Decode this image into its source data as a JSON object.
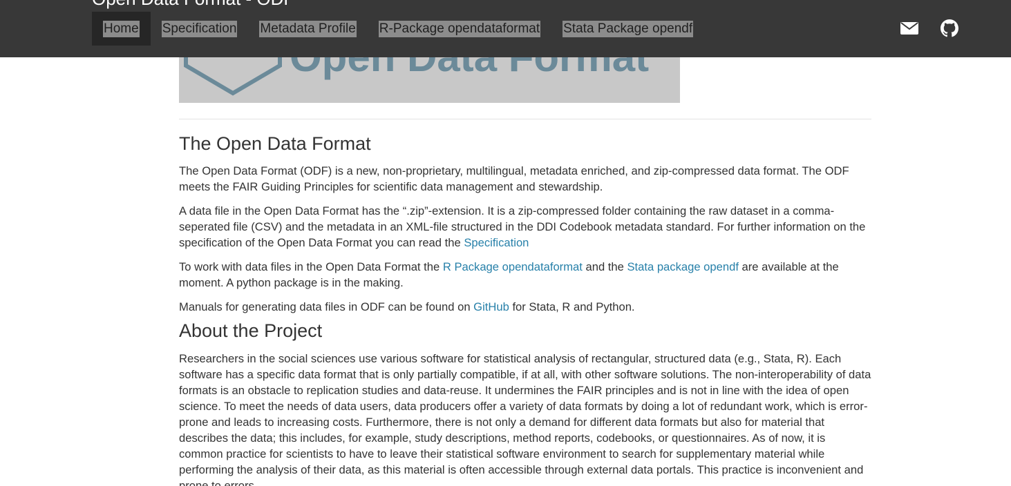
{
  "navbar": {
    "brand": "Open Data Format - ODF",
    "items": [
      {
        "label": "Home"
      },
      {
        "label": "Specification"
      },
      {
        "label": "Metadata Profile"
      },
      {
        "label": "R-Package opendataformat"
      },
      {
        "label": "Stata Package opendf"
      }
    ],
    "icons": [
      "envelope-icon",
      "github-icon"
    ]
  },
  "logo": {
    "text": "Open Data Format"
  },
  "section1": {
    "title": "The Open Data Format",
    "p1": "The Open Data Format (ODF) is a new, non-proprietary, multilingual, metadata enriched, and zip-compressed data format. The ODF meets the FAIR Guiding Principles for scientific data management and stewardship.",
    "p2_text": "A data file in the Open Data Format has the “.zip”-extension. It is a zip-compressed folder containing the raw dataset in a comma-seperated file (CSV) and the metadata in an XML-file structured in the DDI Codebook metadata standard. For further information on the specification of the Open Data Format you can read the ",
    "p2_link": "Specification",
    "p3_a": "To work with data files in the Open Data Format the ",
    "p3_link1": "R Package opendataformat",
    "p3_b": " and the ",
    "p3_link2": "Stata package opendf",
    "p3_c": " are available at the moment. A python package is in the making.",
    "p4_a": "Manuals for generating data files in ODF can be found on ",
    "p4_link": "GitHub",
    "p4_b": " for Stata, R and Python."
  },
  "section2": {
    "title": "About the Project",
    "p1": "Researchers in the social sciences use various software for statistical analysis of rectangular, structured data (e.g., Stata, R). Each software has a specific data format that is only partially compatible, if at all, with other software solutions. The non-interoperability of data formats is an obstacle to replication studies and data-reuse. It undermines the FAIR principles and is not in line with the idea of open science. To meet the needs of data users, data producers offer a variety of data formats by doing a lot of redundant work, which is error-prone and leads to increasing costs. Furthermore, there is not only a demand for different data formats but also for material that describes the data; this includes, for example, study descriptions, method reports, codebooks, or questionnaires. As of now, it is common practice for scientists to have to leave their statistical software environment to search for supplementary material while performing the analysis of their data, as this material is often accessible through external data portals. This practice is inconvenient and prone to errors."
  },
  "colors": {
    "navbar_bg": "#383838",
    "link": "#2780a9",
    "logo_band": "#c8c8c8",
    "logo_text": "#6b8a99"
  }
}
